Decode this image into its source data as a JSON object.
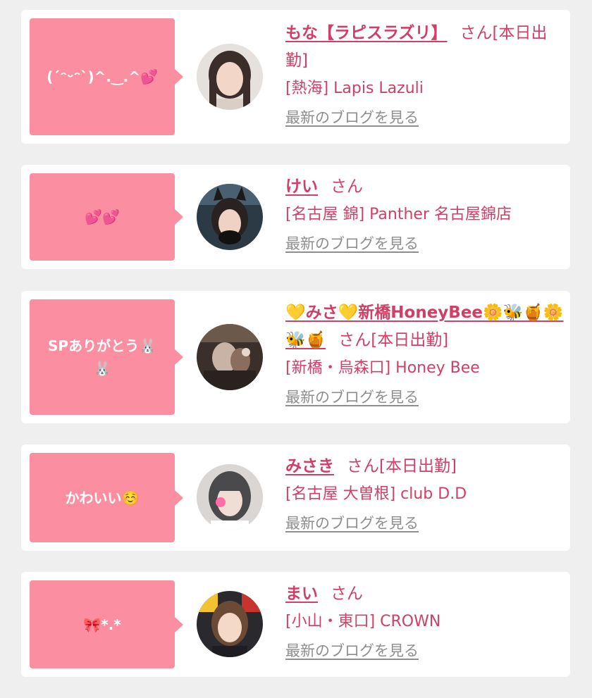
{
  "colors": {
    "background": "#efefef",
    "card": "#ffffff",
    "bubble": "#fb8ea0",
    "accent_text": "#d13f66",
    "link_gray": "#8e8e8e"
  },
  "entries": [
    {
      "message": "(ˊᵔᵕᵔˋ)^.‿.^💕",
      "name": "もな【ラピスラズリ】",
      "honorific": "さん[本日出勤]",
      "shop": "[熱海] Lapis Lazuli",
      "blog_link": "最新のブログを見る"
    },
    {
      "message": "💕💕",
      "name": "けい",
      "honorific": "さん",
      "shop": "[名古屋 錦] Panther 名古屋錦店",
      "blog_link": "最新のブログを見る"
    },
    {
      "message": "SPありがとう🐰🐰",
      "name": "💛みさ💛新橋HoneyBee🌼🐝🍯🌼🐝🍯",
      "honorific": "さん[本日出勤]",
      "shop": "[新橋・烏森口] Honey Bee",
      "blog_link": "最新のブログを見る"
    },
    {
      "message": "かわいい☺️",
      "name": "みさき",
      "honorific": "さん[本日出勤]",
      "shop": "[名古屋 大曽根] club D.D",
      "blog_link": "最新のブログを見る"
    },
    {
      "message": "🎀*.*",
      "name": "まい",
      "honorific": "さん",
      "shop": "[小山・東口] CROWN",
      "blog_link": "最新のブログを見る"
    }
  ]
}
